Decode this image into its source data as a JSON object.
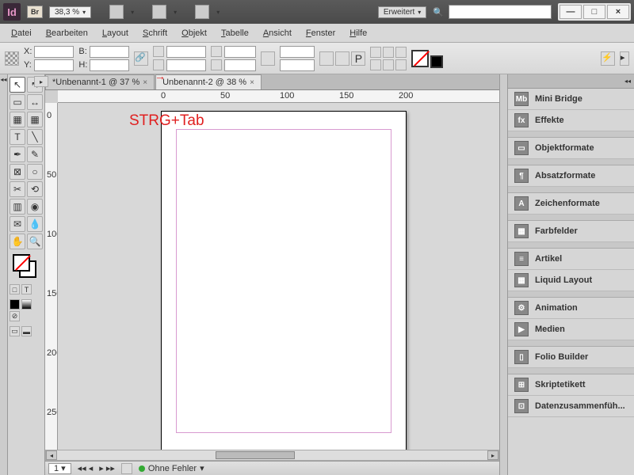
{
  "titlebar": {
    "app_abbrev": "Id",
    "bridge_badge": "Br",
    "zoom": "38,3 %",
    "workspace": "Erweitert"
  },
  "window_controls": {
    "min": "—",
    "max": "□",
    "close": "×"
  },
  "menu": {
    "datei": "Datei",
    "bearbeiten": "Bearbeiten",
    "layout": "Layout",
    "schrift": "Schrift",
    "objekt": "Objekt",
    "tabelle": "Tabelle",
    "ansicht": "Ansicht",
    "fenster": "Fenster",
    "hilfe": "Hilfe"
  },
  "controlbar": {
    "x": "X:",
    "y": "Y:",
    "b": "B:",
    "h": "H:"
  },
  "tabs": [
    {
      "label": "*Unbenannt-1 @ 37 %",
      "active": false
    },
    {
      "label": "Unbenannt-2 @ 38 %",
      "active": true
    }
  ],
  "ruler_h": [
    "0",
    "50",
    "100",
    "150",
    "200"
  ],
  "ruler_v": [
    "0",
    "50",
    "100",
    "150",
    "200",
    "250"
  ],
  "annotation": "STRG+Tab",
  "panels": [
    {
      "icon": "Mb",
      "label": "Mini Bridge"
    },
    {
      "icon": "fx",
      "label": "Effekte"
    },
    {
      "gap": true
    },
    {
      "icon": "▭",
      "label": "Objektformate"
    },
    {
      "gap": true
    },
    {
      "icon": "¶",
      "label": "Absatzformate"
    },
    {
      "gap": true
    },
    {
      "icon": "A",
      "label": "Zeichenformate"
    },
    {
      "gap": true
    },
    {
      "icon": "▦",
      "label": "Farbfelder"
    },
    {
      "gap": true
    },
    {
      "icon": "≡",
      "label": "Artikel"
    },
    {
      "icon": "▦",
      "label": "Liquid Layout"
    },
    {
      "gap": true
    },
    {
      "icon": "⚙",
      "label": "Animation"
    },
    {
      "icon": "▶",
      "label": "Medien"
    },
    {
      "gap": true
    },
    {
      "icon": "▯",
      "label": "Folio Builder"
    },
    {
      "gap": true
    },
    {
      "icon": "⊞",
      "label": "Skriptetikett"
    },
    {
      "icon": "⊡",
      "label": "Datenzusammenfüh..."
    }
  ],
  "status": {
    "page": "1",
    "errors": "Ohne Fehler"
  }
}
